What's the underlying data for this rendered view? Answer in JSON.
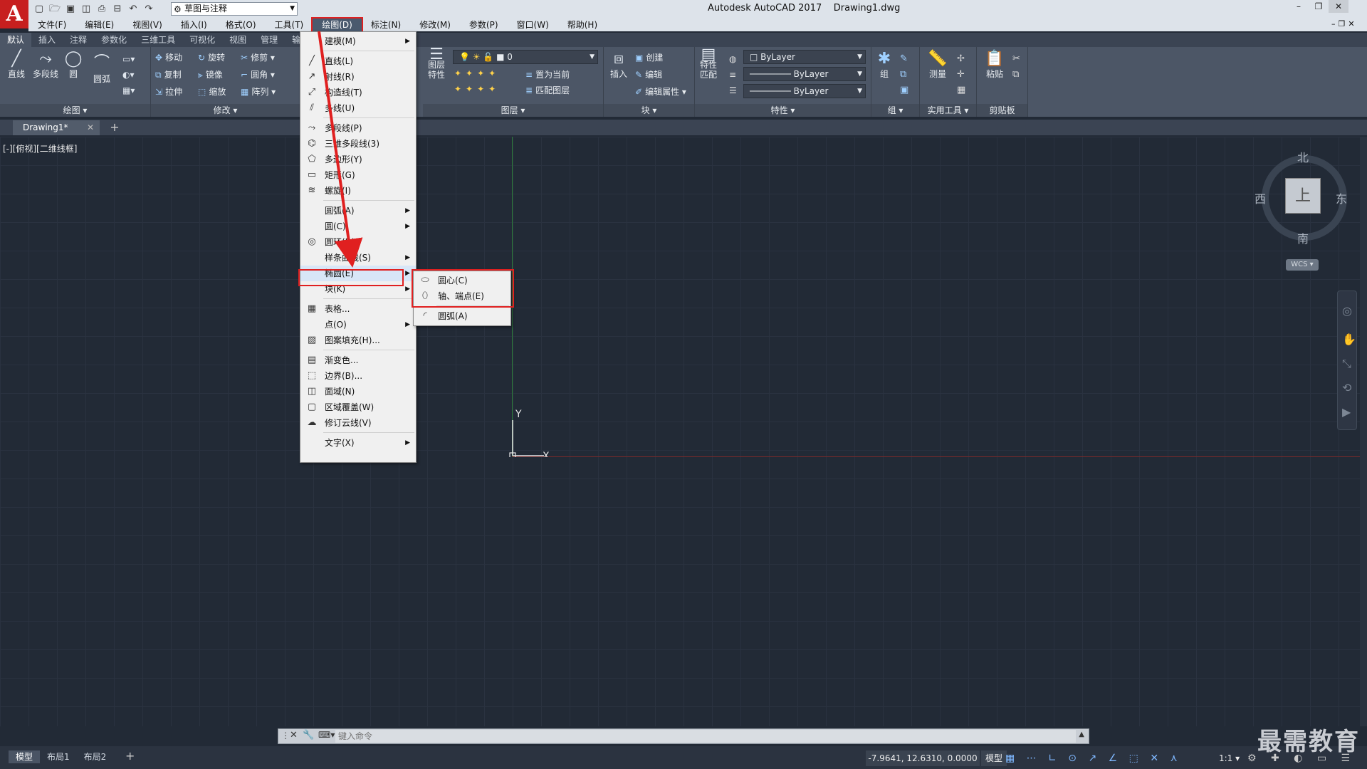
{
  "app": {
    "title": "Autodesk AutoCAD 2017",
    "document": "Drawing1.dwg",
    "logo": "A",
    "workspace": "草图与注释"
  },
  "menubar": [
    "文件(F)",
    "编辑(E)",
    "视图(V)",
    "插入(I)",
    "格式(O)",
    "工具(T)",
    "绘图(D)",
    "标注(N)",
    "修改(M)",
    "参数(P)",
    "窗口(W)",
    "帮助(H)"
  ],
  "ribbon_tabs": [
    "默认",
    "插入",
    "注释",
    "参数化",
    "三维工具",
    "可视化",
    "视图",
    "管理",
    "输出"
  ],
  "ribbon": {
    "draw": {
      "line": "直线",
      "polyline": "多段线",
      "circle": "圆",
      "arc": "圆弧",
      "label": "绘图"
    },
    "modify": {
      "move": "移动",
      "rotate": "旋转",
      "trim": "修剪",
      "copy": "复制",
      "mirror": "镜像",
      "fillet": "圆角",
      "stretch": "拉伸",
      "scale": "缩放",
      "array": "阵列",
      "label": "修改"
    },
    "layers": {
      "layer_props": "图层\n特性",
      "current_layer": "0",
      "make_current": "置为当前",
      "match_layer": "匹配图层",
      "label": "图层"
    },
    "block": {
      "insert": "插入",
      "create": "创建",
      "edit": "编辑",
      "edit_attr": "编辑属性",
      "label": "块"
    },
    "properties": {
      "match": "特性\n匹配",
      "color": "ByLayer",
      "linetype": "ByLayer",
      "lineweight": "ByLayer",
      "label": "特性"
    },
    "groups": {
      "group": "组",
      "label": "组"
    },
    "utilities": {
      "measure": "测量",
      "label": "实用工具"
    },
    "clipboard": {
      "paste": "粘贴",
      "label": "剪贴板"
    }
  },
  "file_tab": "Drawing1*",
  "viewport_label": "[-][俯视][二维线框]",
  "viewcube": {
    "north": "北",
    "south": "南",
    "east": "东",
    "west": "西",
    "top": "上",
    "wcs": "WCS"
  },
  "ucs": {
    "x": "X",
    "y": "Y"
  },
  "draw_menu": [
    {
      "label": "建模(M)",
      "sub": true,
      "icon": ""
    },
    {
      "sep": true
    },
    {
      "label": "直线(L)",
      "icon": "line-icon"
    },
    {
      "label": "射线(R)",
      "icon": "ray-icon"
    },
    {
      "label": "构造线(T)",
      "icon": "xline-icon"
    },
    {
      "label": "多线(U)",
      "icon": "mline-icon"
    },
    {
      "sep": true
    },
    {
      "label": "多段线(P)",
      "icon": "pline-icon"
    },
    {
      "label": "三维多段线(3)",
      "icon": "3dpoly-icon"
    },
    {
      "label": "多边形(Y)",
      "icon": "polygon-icon"
    },
    {
      "label": "矩形(G)",
      "icon": "rectangle-icon"
    },
    {
      "label": "螺旋(I)",
      "icon": "helix-icon"
    },
    {
      "sep": true
    },
    {
      "label": "圆弧(A)",
      "sub": true
    },
    {
      "label": "圆(C)",
      "sub": true
    },
    {
      "label": "圆环(D)",
      "icon": "donut-icon"
    },
    {
      "label": "样条曲线(S)",
      "sub": true
    },
    {
      "label": "椭圆(E)",
      "sub": true,
      "highlight": true
    },
    {
      "label": "块(K)",
      "sub": true
    },
    {
      "sep": true
    },
    {
      "label": "表格...",
      "icon": "table-icon"
    },
    {
      "label": "点(O)",
      "sub": true
    },
    {
      "label": "图案填充(H)...",
      "icon": "hatch-icon"
    },
    {
      "sep": true
    },
    {
      "label": "渐变色...",
      "icon": "gradient-icon"
    },
    {
      "label": "边界(B)...",
      "icon": "boundary-icon"
    },
    {
      "label": "面域(N)",
      "icon": "region-icon"
    },
    {
      "label": "区域覆盖(W)",
      "icon": "wipeout-icon"
    },
    {
      "label": "修订云线(V)",
      "icon": "revcloud-icon"
    },
    {
      "sep": true
    },
    {
      "label": "文字(X)",
      "sub": true
    }
  ],
  "ellipse_menu": [
    {
      "label": "圆心(C)",
      "icon": "ellipse-center-icon"
    },
    {
      "label": "轴、端点(E)",
      "icon": "ellipse-axis-icon"
    },
    {
      "sep": true
    },
    {
      "label": "圆弧(A)",
      "icon": "ellipse-arc-icon"
    }
  ],
  "command": {
    "placeholder": "键入命令"
  },
  "layout_tabs": [
    "模型",
    "布局1",
    "布局2"
  ],
  "status": {
    "coords": "-7.9641, 12.6310, 0.0000",
    "model": "模型",
    "scale": "1:1"
  },
  "watermark": "最需教育"
}
